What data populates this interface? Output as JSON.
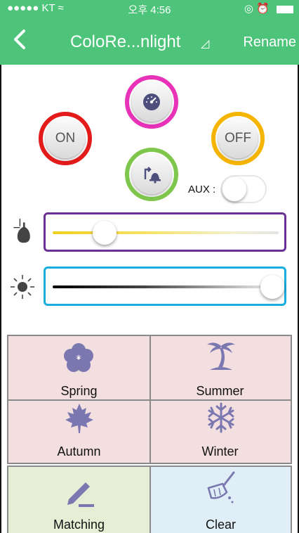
{
  "status_bar": {
    "carrier": "●●●●● KT ≈",
    "time": "오후 4:56",
    "right_icons": "◎ ⏰"
  },
  "nav": {
    "back_icon": "chevron-left-icon",
    "title": "ColoRe...nlight",
    "title_caret": "◿",
    "rename_label": "Rename"
  },
  "controls": {
    "on_label": "ON",
    "off_label": "OFF",
    "timer_icon": "timer-dial-icon",
    "scene_icon": "bell-repeat-icon",
    "aux_label": "AUX :",
    "aux_on": false,
    "colors": {
      "on": "#e31b1b",
      "off": "#f4b400",
      "timer": "#e832b8",
      "scene": "#7fc74c"
    }
  },
  "sliders": {
    "temperature": {
      "icon": "bulb-icon",
      "level": 0.22,
      "border_color": "#6b3093"
    },
    "brightness": {
      "icon": "sun-icon",
      "level": 1.0,
      "border_color": "#1aaede"
    }
  },
  "seasons": [
    {
      "label": "Spring",
      "icon": "flower-icon"
    },
    {
      "label": "Summer",
      "icon": "palm-tree-icon"
    },
    {
      "label": "Autumn",
      "icon": "maple-leaf-icon"
    },
    {
      "label": "Winter",
      "icon": "snowflake-icon"
    }
  ],
  "actions": [
    {
      "label": "Matching",
      "icon": "pencil-icon",
      "bg": "#e6efd6"
    },
    {
      "label": "Clear",
      "icon": "broom-icon",
      "bg": "#e0eff7"
    }
  ],
  "icon_color": "#7b78b1",
  "theme": {
    "nav_bg": "#4dc47a",
    "season_bg": "#f4dfe0"
  }
}
